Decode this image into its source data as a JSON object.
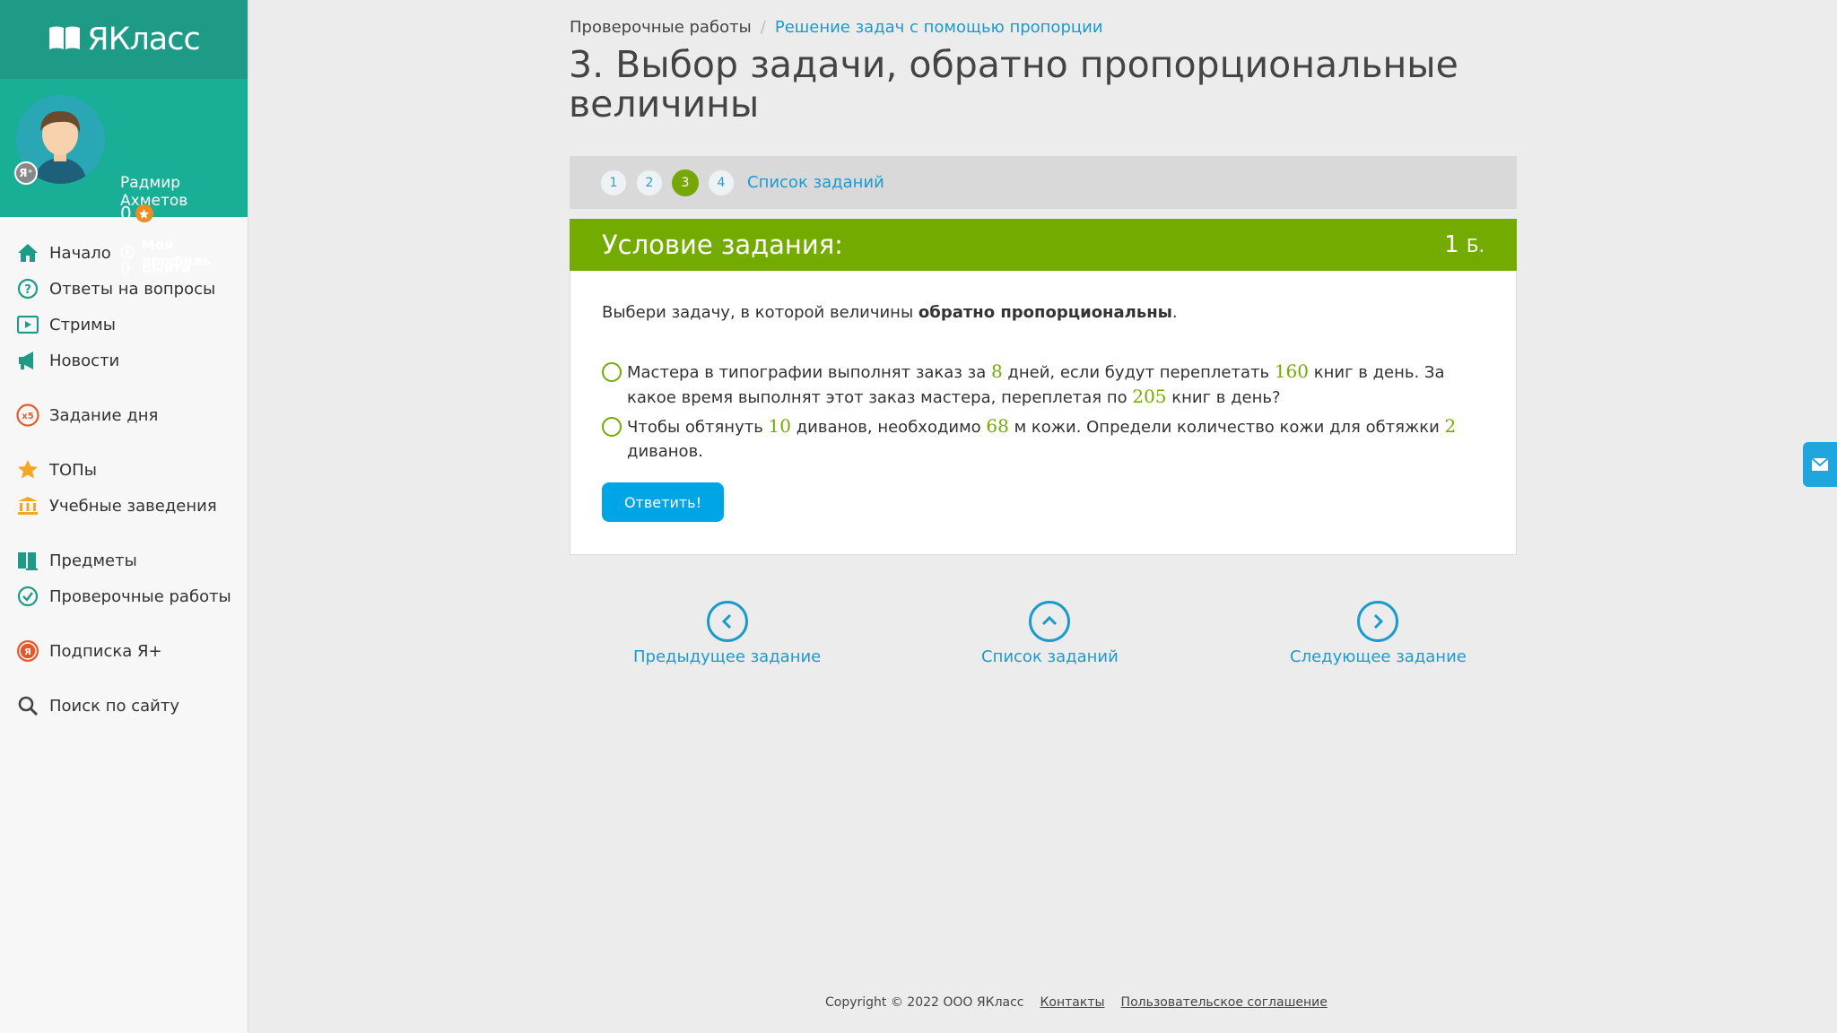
{
  "app": {
    "logo": "ЯКласс"
  },
  "user": {
    "name": "Радмир Ахметов",
    "points": "0",
    "badge": "Я⁺",
    "profile_label": "Мой профиль",
    "logout_label": "Выйти"
  },
  "nav": {
    "home": "Начало",
    "answers": "Ответы на вопросы",
    "streams": "Стримы",
    "news": "Новости",
    "task_of_day": "Задание дня",
    "tops": "ТОПы",
    "institutions": "Учебные заведения",
    "subjects": "Предметы",
    "tests": "Проверочные работы",
    "subscription": "Подписка Я+",
    "search": "Поиск по сайту",
    "x5_badge": "x5"
  },
  "breadcrumb": {
    "parent": "Проверочные работы",
    "separator": "/",
    "current": "Решение задач с помощью пропорции"
  },
  "page": {
    "title": "3. Выбор задачи, обратно пропорциональные величины"
  },
  "tasks_bar": {
    "numbers": [
      "1",
      "2",
      "3",
      "4"
    ],
    "active": "3",
    "list_label": "Список заданий"
  },
  "condition": {
    "title": "Условие задания:",
    "points_value": "1",
    "points_unit": "Б.",
    "instruction_pre": "Выбери задачу, в которой величины ",
    "instruction_bold": "обратно пропорциональны",
    "instruction_post": ".",
    "option1": {
      "t1": "Мастера в типографии выполнят заказ за ",
      "n1": "8",
      "t2": " дней, если будут переплетать ",
      "n2": "160",
      "t3": " книг в день. За какое время выполнят этот заказ мастера, переплетая по ",
      "n3": "205",
      "t4": " книг в день?"
    },
    "option2": {
      "t1": "Чтобы обтянуть ",
      "n1": "10",
      "t2": " диванов, необходимо ",
      "n2": "68",
      "t3": " м кожи. Определи количество кожи для обтяжки ",
      "n3": "2",
      "t4": " диванов."
    },
    "answer_button": "Ответить!"
  },
  "bottom_nav": {
    "prev": "Предыдущее задание",
    "list": "Список заданий",
    "next": "Следующее задание"
  },
  "footer": {
    "copyright": "Copyright © 2022 ООО ЯКласс",
    "contacts": "Контакты",
    "agreement": "Пользовательское соглашение"
  },
  "colors": {
    "brand_teal": "#1e9b87",
    "accent_green": "#74ab00",
    "link_blue": "#1b9bcd",
    "button_blue": "#00a5e5"
  }
}
